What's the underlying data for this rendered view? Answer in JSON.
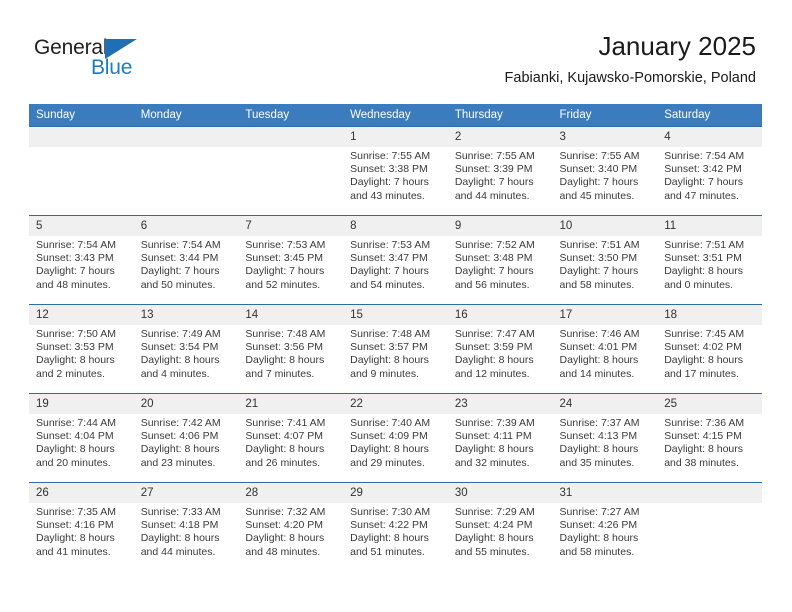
{
  "brand": {
    "name_part1": "General",
    "name_part2": "Blue",
    "triangle_color": "#1f6fb5",
    "blue_text_color": "#1f7cc4"
  },
  "header": {
    "title": "January 2025",
    "subtitle": "Fabianki, Kujawsko-Pomorskie, Poland"
  },
  "theme": {
    "header_row_color": "#3a7cbe",
    "daynum_band_color": "#f0f0f0",
    "row_divider_color": "#2e6da4"
  },
  "weekdays": [
    "Sunday",
    "Monday",
    "Tuesday",
    "Wednesday",
    "Thursday",
    "Friday",
    "Saturday"
  ],
  "weeks": [
    [
      {
        "day": "",
        "lines": []
      },
      {
        "day": "",
        "lines": []
      },
      {
        "day": "",
        "lines": []
      },
      {
        "day": "1",
        "lines": [
          "Sunrise: 7:55 AM",
          "Sunset: 3:38 PM",
          "Daylight: 7 hours",
          "and 43 minutes."
        ]
      },
      {
        "day": "2",
        "lines": [
          "Sunrise: 7:55 AM",
          "Sunset: 3:39 PM",
          "Daylight: 7 hours",
          "and 44 minutes."
        ]
      },
      {
        "day": "3",
        "lines": [
          "Sunrise: 7:55 AM",
          "Sunset: 3:40 PM",
          "Daylight: 7 hours",
          "and 45 minutes."
        ]
      },
      {
        "day": "4",
        "lines": [
          "Sunrise: 7:54 AM",
          "Sunset: 3:42 PM",
          "Daylight: 7 hours",
          "and 47 minutes."
        ]
      }
    ],
    [
      {
        "day": "5",
        "lines": [
          "Sunrise: 7:54 AM",
          "Sunset: 3:43 PM",
          "Daylight: 7 hours",
          "and 48 minutes."
        ]
      },
      {
        "day": "6",
        "lines": [
          "Sunrise: 7:54 AM",
          "Sunset: 3:44 PM",
          "Daylight: 7 hours",
          "and 50 minutes."
        ]
      },
      {
        "day": "7",
        "lines": [
          "Sunrise: 7:53 AM",
          "Sunset: 3:45 PM",
          "Daylight: 7 hours",
          "and 52 minutes."
        ]
      },
      {
        "day": "8",
        "lines": [
          "Sunrise: 7:53 AM",
          "Sunset: 3:47 PM",
          "Daylight: 7 hours",
          "and 54 minutes."
        ]
      },
      {
        "day": "9",
        "lines": [
          "Sunrise: 7:52 AM",
          "Sunset: 3:48 PM",
          "Daylight: 7 hours",
          "and 56 minutes."
        ]
      },
      {
        "day": "10",
        "lines": [
          "Sunrise: 7:51 AM",
          "Sunset: 3:50 PM",
          "Daylight: 7 hours",
          "and 58 minutes."
        ]
      },
      {
        "day": "11",
        "lines": [
          "Sunrise: 7:51 AM",
          "Sunset: 3:51 PM",
          "Daylight: 8 hours",
          "and 0 minutes."
        ]
      }
    ],
    [
      {
        "day": "12",
        "lines": [
          "Sunrise: 7:50 AM",
          "Sunset: 3:53 PM",
          "Daylight: 8 hours",
          "and 2 minutes."
        ]
      },
      {
        "day": "13",
        "lines": [
          "Sunrise: 7:49 AM",
          "Sunset: 3:54 PM",
          "Daylight: 8 hours",
          "and 4 minutes."
        ]
      },
      {
        "day": "14",
        "lines": [
          "Sunrise: 7:48 AM",
          "Sunset: 3:56 PM",
          "Daylight: 8 hours",
          "and 7 minutes."
        ]
      },
      {
        "day": "15",
        "lines": [
          "Sunrise: 7:48 AM",
          "Sunset: 3:57 PM",
          "Daylight: 8 hours",
          "and 9 minutes."
        ]
      },
      {
        "day": "16",
        "lines": [
          "Sunrise: 7:47 AM",
          "Sunset: 3:59 PM",
          "Daylight: 8 hours",
          "and 12 minutes."
        ]
      },
      {
        "day": "17",
        "lines": [
          "Sunrise: 7:46 AM",
          "Sunset: 4:01 PM",
          "Daylight: 8 hours",
          "and 14 minutes."
        ]
      },
      {
        "day": "18",
        "lines": [
          "Sunrise: 7:45 AM",
          "Sunset: 4:02 PM",
          "Daylight: 8 hours",
          "and 17 minutes."
        ]
      }
    ],
    [
      {
        "day": "19",
        "lines": [
          "Sunrise: 7:44 AM",
          "Sunset: 4:04 PM",
          "Daylight: 8 hours",
          "and 20 minutes."
        ]
      },
      {
        "day": "20",
        "lines": [
          "Sunrise: 7:42 AM",
          "Sunset: 4:06 PM",
          "Daylight: 8 hours",
          "and 23 minutes."
        ]
      },
      {
        "day": "21",
        "lines": [
          "Sunrise: 7:41 AM",
          "Sunset: 4:07 PM",
          "Daylight: 8 hours",
          "and 26 minutes."
        ]
      },
      {
        "day": "22",
        "lines": [
          "Sunrise: 7:40 AM",
          "Sunset: 4:09 PM",
          "Daylight: 8 hours",
          "and 29 minutes."
        ]
      },
      {
        "day": "23",
        "lines": [
          "Sunrise: 7:39 AM",
          "Sunset: 4:11 PM",
          "Daylight: 8 hours",
          "and 32 minutes."
        ]
      },
      {
        "day": "24",
        "lines": [
          "Sunrise: 7:37 AM",
          "Sunset: 4:13 PM",
          "Daylight: 8 hours",
          "and 35 minutes."
        ]
      },
      {
        "day": "25",
        "lines": [
          "Sunrise: 7:36 AM",
          "Sunset: 4:15 PM",
          "Daylight: 8 hours",
          "and 38 minutes."
        ]
      }
    ],
    [
      {
        "day": "26",
        "lines": [
          "Sunrise: 7:35 AM",
          "Sunset: 4:16 PM",
          "Daylight: 8 hours",
          "and 41 minutes."
        ]
      },
      {
        "day": "27",
        "lines": [
          "Sunrise: 7:33 AM",
          "Sunset: 4:18 PM",
          "Daylight: 8 hours",
          "and 44 minutes."
        ]
      },
      {
        "day": "28",
        "lines": [
          "Sunrise: 7:32 AM",
          "Sunset: 4:20 PM",
          "Daylight: 8 hours",
          "and 48 minutes."
        ]
      },
      {
        "day": "29",
        "lines": [
          "Sunrise: 7:30 AM",
          "Sunset: 4:22 PM",
          "Daylight: 8 hours",
          "and 51 minutes."
        ]
      },
      {
        "day": "30",
        "lines": [
          "Sunrise: 7:29 AM",
          "Sunset: 4:24 PM",
          "Daylight: 8 hours",
          "and 55 minutes."
        ]
      },
      {
        "day": "31",
        "lines": [
          "Sunrise: 7:27 AM",
          "Sunset: 4:26 PM",
          "Daylight: 8 hours",
          "and 58 minutes."
        ]
      },
      {
        "day": "",
        "lines": []
      }
    ]
  ]
}
